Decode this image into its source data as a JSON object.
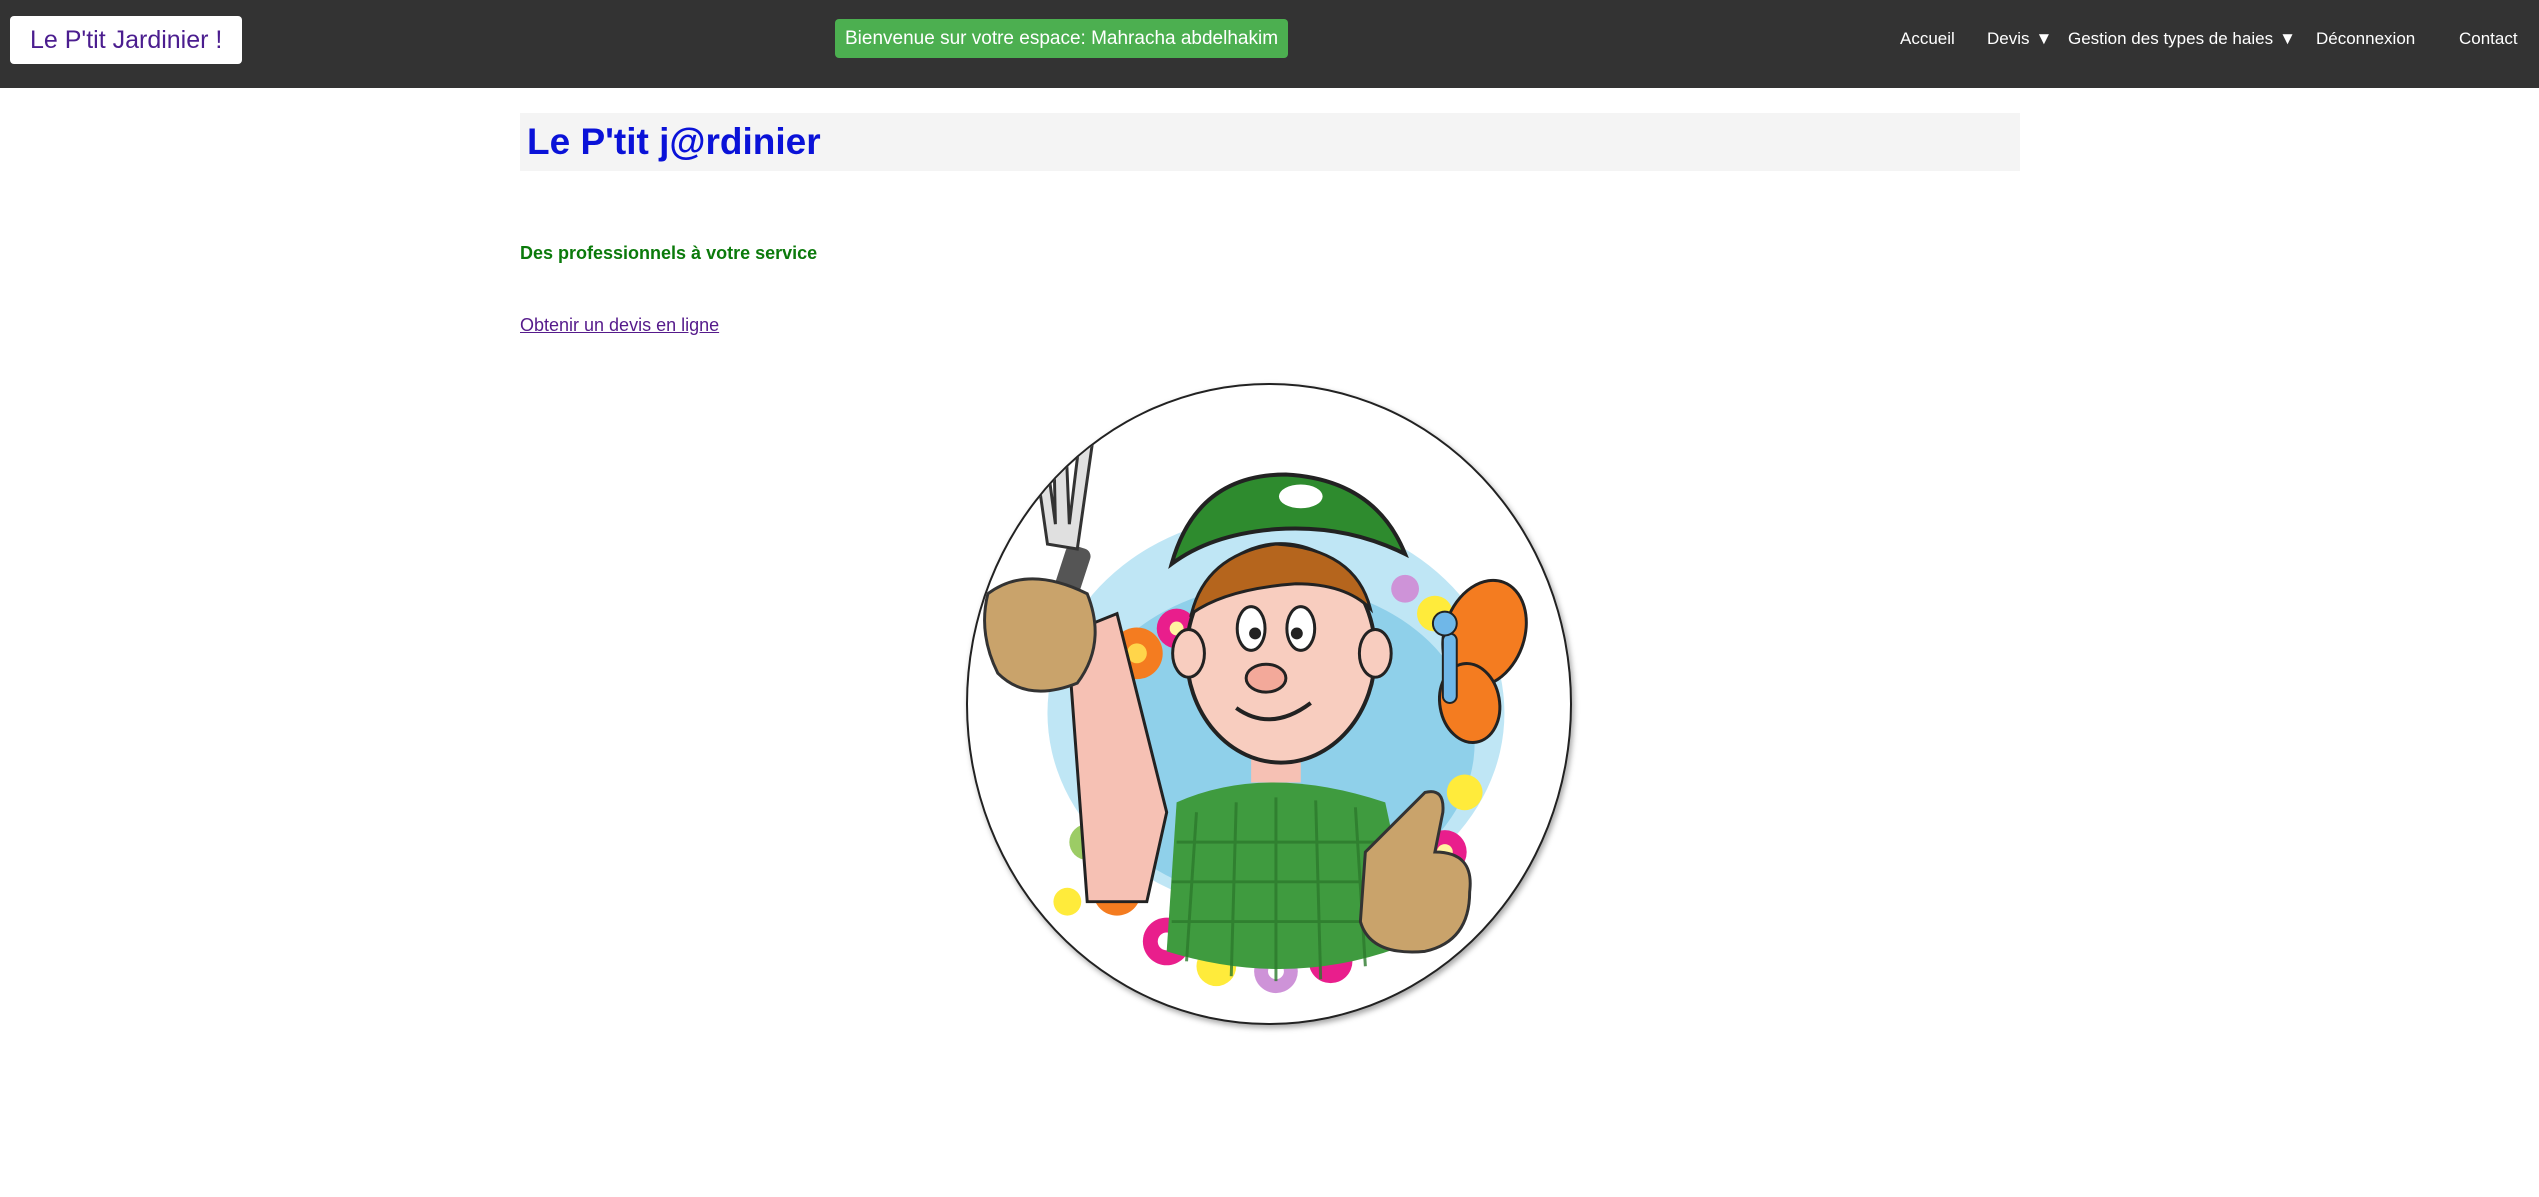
{
  "header": {
    "brand": "Le P'tit Jardinier !",
    "welcome": "Bienvenue sur votre espace: Mahracha abdelhakim",
    "nav": {
      "accueil": "Accueil",
      "devis": "Devis",
      "gestion": "Gestion des types de haies",
      "deconnexion": "Déconnexion",
      "contact": "Contact"
    },
    "caret": "▼"
  },
  "main": {
    "title": "Le P'tit j@rdinier",
    "tagline": "Des professionnels à votre service",
    "quote_link": "Obtenir un devis en ligne"
  },
  "colors": {
    "topbar": "#333333",
    "welcome_bg": "#4caf50",
    "title": "#0a12d8",
    "tagline": "#0b7a0b",
    "link": "#551a8b"
  },
  "icons": {
    "dropdown": "caret-down-icon"
  }
}
